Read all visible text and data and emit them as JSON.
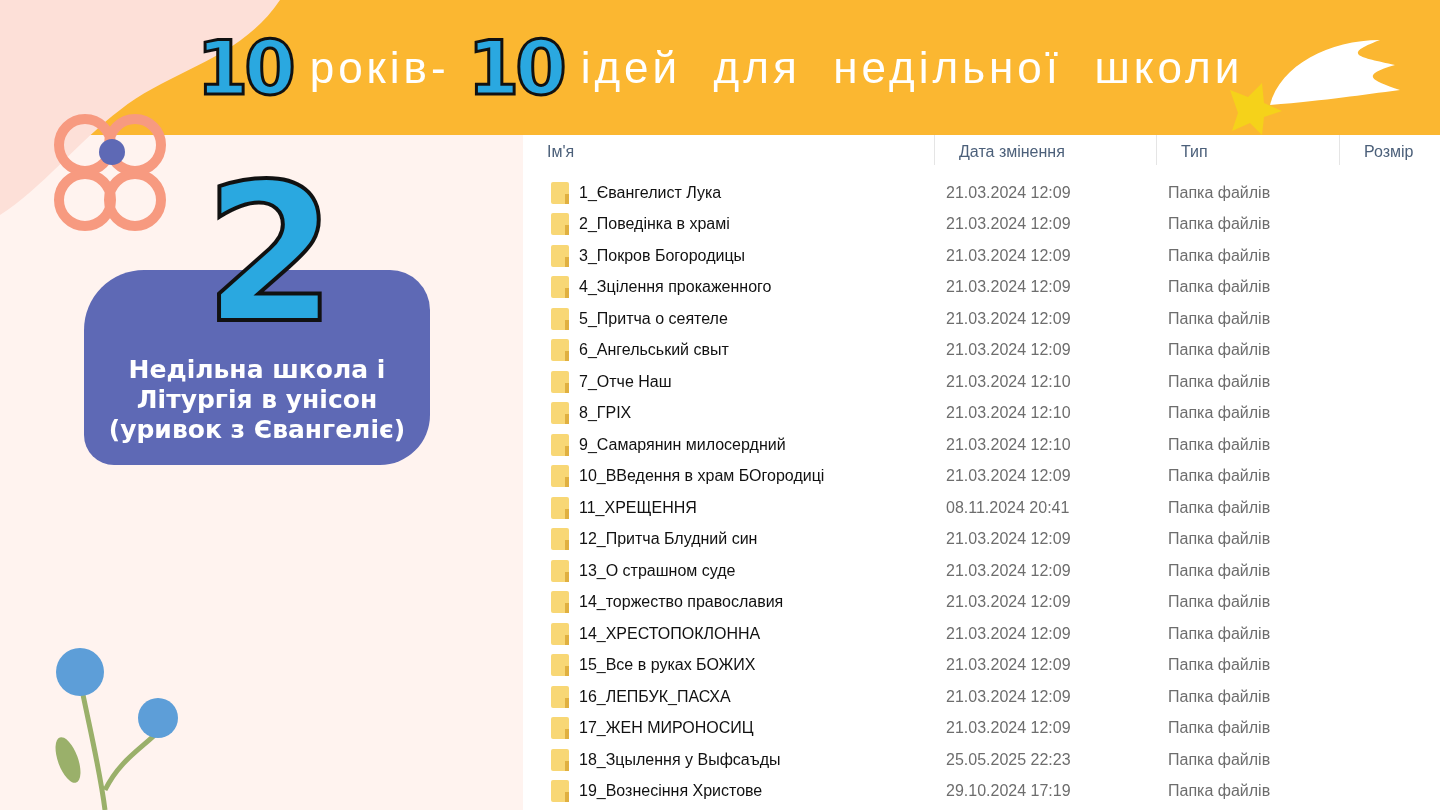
{
  "banner": {
    "title": [
      {
        "kind": "number",
        "text": "10"
      },
      {
        "kind": "word",
        "text": "років-"
      },
      {
        "kind": "number",
        "text": "10"
      },
      {
        "kind": "word",
        "text": "ідей  для  недільної  школи"
      }
    ]
  },
  "lesson": {
    "number": "2",
    "caption": "Недільна школа і Літургія в унісон (уривок з Євангеліє)"
  },
  "explorer": {
    "columns": [
      "Ім'я",
      "Дата змінення",
      "Тип",
      "Розмір"
    ],
    "rows": [
      {
        "name": "1_Євангелист Лука",
        "modified": "21.03.2024 12:09",
        "type": "Папка файлів"
      },
      {
        "name": "2_Поведінка в храмі",
        "modified": "21.03.2024 12:09",
        "type": "Папка файлів"
      },
      {
        "name": "3_Покров Богородицы",
        "modified": "21.03.2024 12:09",
        "type": "Папка файлів"
      },
      {
        "name": "4_Зцілення прокаженного",
        "modified": "21.03.2024 12:09",
        "type": "Папка файлів"
      },
      {
        "name": "5_Притча о сеятеле",
        "modified": "21.03.2024 12:09",
        "type": "Папка файлів"
      },
      {
        "name": "6_Ангельський свыт",
        "modified": "21.03.2024 12:09",
        "type": "Папка файлів"
      },
      {
        "name": "7_Отче Наш",
        "modified": "21.03.2024 12:10",
        "type": "Папка файлів"
      },
      {
        "name": "8_ГРІХ",
        "modified": "21.03.2024 12:10",
        "type": "Папка файлів"
      },
      {
        "name": "9_Самарянин милосердний",
        "modified": "21.03.2024 12:10",
        "type": "Папка файлів"
      },
      {
        "name": "10_ВВедення в храм БОгородиці",
        "modified": "21.03.2024 12:09",
        "type": "Папка файлів"
      },
      {
        "name": "11_ХРЕЩЕННЯ",
        "modified": "08.11.2024 20:41",
        "type": "Папка файлів"
      },
      {
        "name": "12_Притча Блудний син",
        "modified": "21.03.2024 12:09",
        "type": "Папка файлів"
      },
      {
        "name": "13_О страшном суде",
        "modified": "21.03.2024 12:09",
        "type": "Папка файлів"
      },
      {
        "name": "14_торжество православия",
        "modified": "21.03.2024 12:09",
        "type": "Папка файлів"
      },
      {
        "name": "14_ХРЕСТОПОКЛОННА",
        "modified": "21.03.2024 12:09",
        "type": "Папка файлів"
      },
      {
        "name": "15_Все в руках БОЖИХ",
        "modified": "21.03.2024 12:09",
        "type": "Папка файлів"
      },
      {
        "name": "16_ЛЕПБУК_ПАСХА",
        "modified": "21.03.2024 12:09",
        "type": "Папка файлів"
      },
      {
        "name": "17_ЖЕН МИРОНОСИЦ",
        "modified": "21.03.2024 12:09",
        "type": "Папка файлів"
      },
      {
        "name": "18_Зцылення у Выфсаъды",
        "modified": "25.05.2025 22:23",
        "type": "Папка файлів"
      },
      {
        "name": "19_Вознесіння Христове",
        "modified": "29.10.2024 17:19",
        "type": "Папка файлів"
      }
    ]
  }
}
